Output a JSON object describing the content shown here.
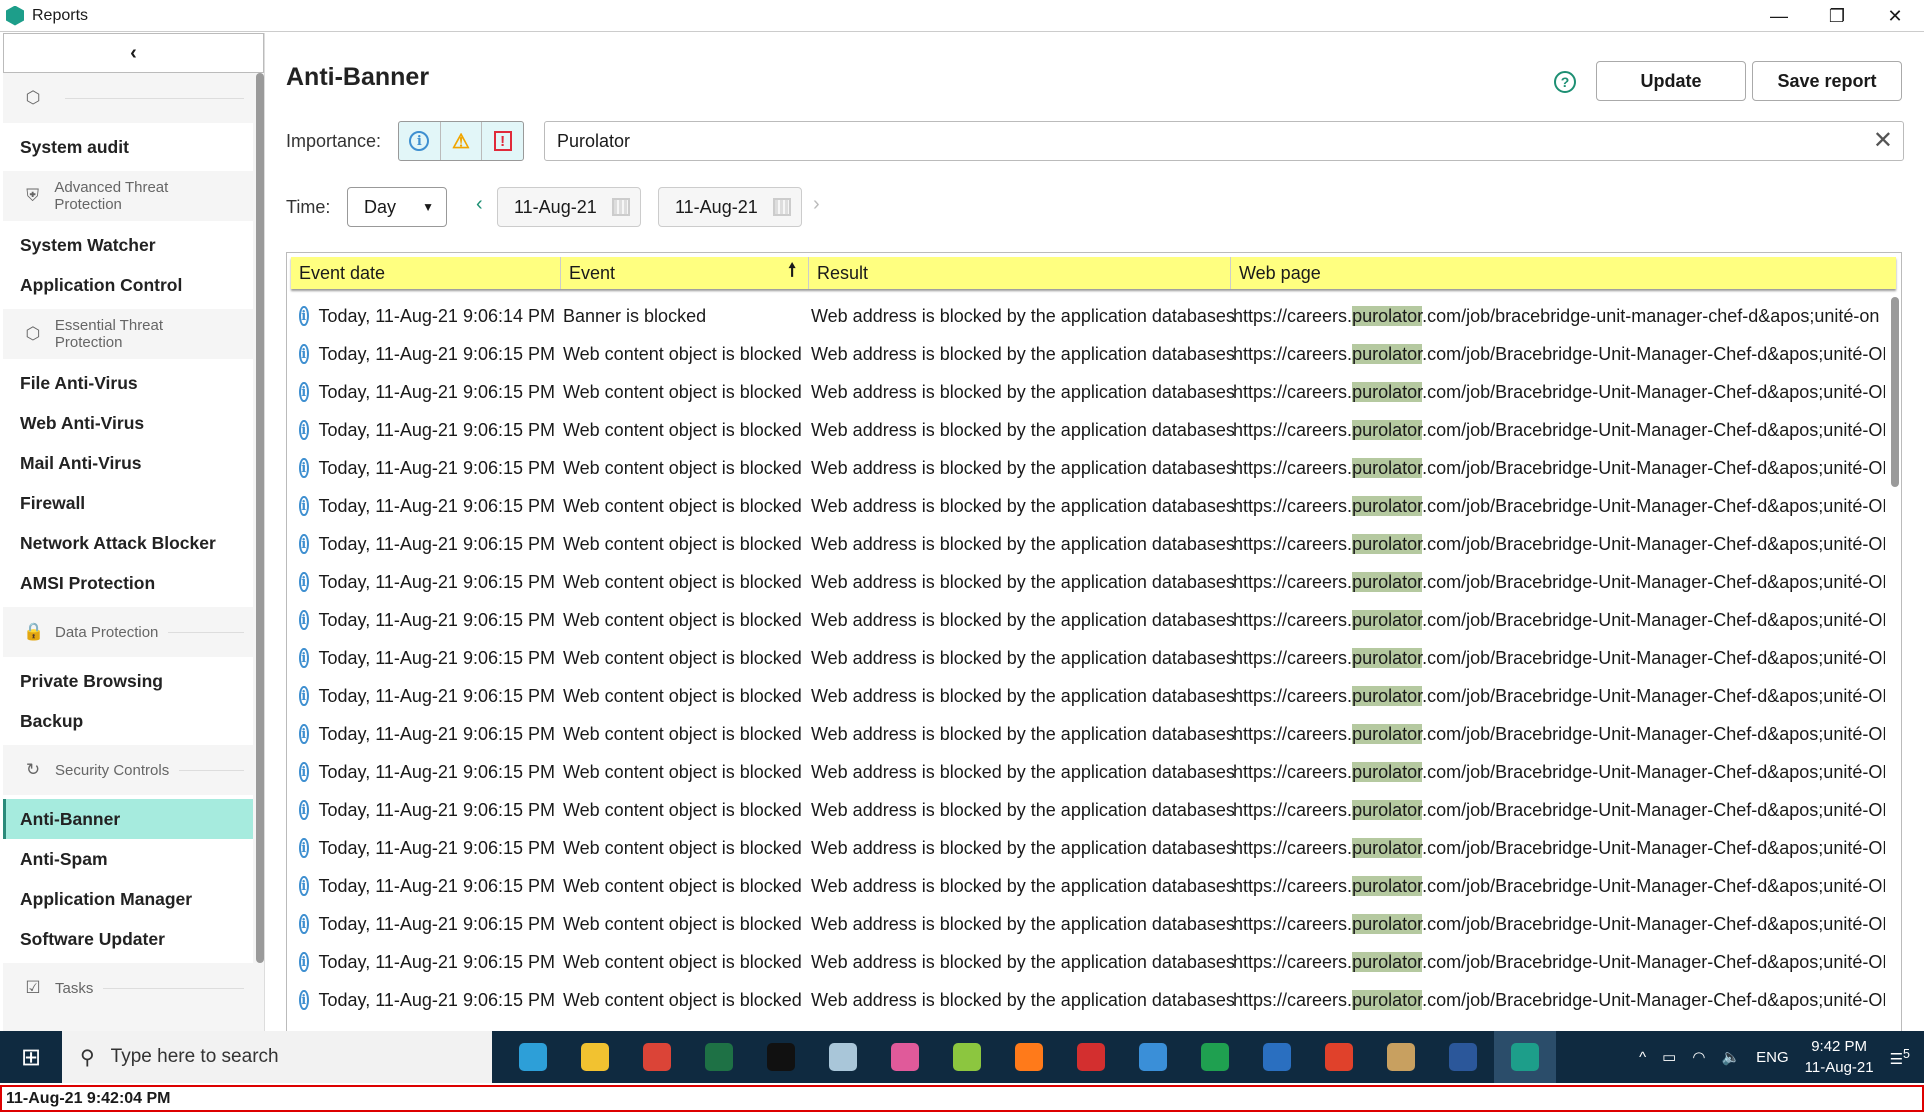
{
  "window": {
    "title": "Reports",
    "minimize": "—",
    "restore": "❐",
    "close": "✕"
  },
  "sidebar": {
    "collapse_icon": "‹",
    "sections": [
      {
        "icon": "⬡",
        "label": "",
        "items": [
          "System audit"
        ]
      },
      {
        "icon": "⛨",
        "label": "Advanced Threat Protection",
        "items": [
          "System Watcher",
          "Application Control"
        ]
      },
      {
        "icon": "⬡",
        "label": "Essential Threat Protection",
        "items": [
          "File Anti-Virus",
          "Web Anti-Virus",
          "Mail Anti-Virus",
          "Firewall",
          "Network Attack Blocker",
          "AMSI Protection"
        ]
      },
      {
        "icon": "🔒",
        "label": "Data Protection",
        "items": [
          "Private Browsing",
          "Backup"
        ]
      },
      {
        "icon": "↻",
        "label": "Security Controls",
        "items": [
          "Anti-Banner",
          "Anti-Spam",
          "Application Manager",
          "Software Updater"
        ]
      },
      {
        "icon": "☑",
        "label": "Tasks",
        "items": []
      }
    ],
    "active_item": "Anti-Banner"
  },
  "header": {
    "title": "Anti-Banner",
    "help_icon": "?",
    "update_label": "Update",
    "save_label": "Save report"
  },
  "filters": {
    "importance_label": "Importance:",
    "importance_icons": {
      "info": "i",
      "warning": "⚠",
      "critical": "!"
    },
    "search_value": "Purolator",
    "clear_icon": "✕",
    "time_label": "Time:",
    "period": "Day",
    "prev_icon": "‹",
    "next_icon": "›",
    "date_from": "11-Aug-21",
    "date_to": "11-Aug-21"
  },
  "table": {
    "columns": [
      "Event date",
      "Event",
      "Result",
      "Web page"
    ],
    "sort_icon": "🠕",
    "highlight": "purolator",
    "rows": [
      {
        "date": "Today, 11-Aug-21 9:06:14 PM",
        "event": "Banner is blocked",
        "result": "Web address is blocked by the application databases",
        "url": "https://careers.purolator.com/job/bracebridge-unit-manager-chef-d&apos;unité-on"
      },
      {
        "date": "Today, 11-Aug-21 9:06:15 PM",
        "event": "Web content object is blocked",
        "result": "Web address is blocked by the application databases",
        "url": "https://careers.purolator.com/job/Bracebridge-Unit-Manager-Chef-d&apos;unité-ON"
      },
      {
        "date": "Today, 11-Aug-21 9:06:15 PM",
        "event": "Web content object is blocked",
        "result": "Web address is blocked by the application databases",
        "url": "https://careers.purolator.com/job/Bracebridge-Unit-Manager-Chef-d&apos;unité-ON"
      },
      {
        "date": "Today, 11-Aug-21 9:06:15 PM",
        "event": "Web content object is blocked",
        "result": "Web address is blocked by the application databases",
        "url": "https://careers.purolator.com/job/Bracebridge-Unit-Manager-Chef-d&apos;unité-ON"
      },
      {
        "date": "Today, 11-Aug-21 9:06:15 PM",
        "event": "Web content object is blocked",
        "result": "Web address is blocked by the application databases",
        "url": "https://careers.purolator.com/job/Bracebridge-Unit-Manager-Chef-d&apos;unité-ON"
      },
      {
        "date": "Today, 11-Aug-21 9:06:15 PM",
        "event": "Web content object is blocked",
        "result": "Web address is blocked by the application databases",
        "url": "https://careers.purolator.com/job/Bracebridge-Unit-Manager-Chef-d&apos;unité-ON"
      },
      {
        "date": "Today, 11-Aug-21 9:06:15 PM",
        "event": "Web content object is blocked",
        "result": "Web address is blocked by the application databases",
        "url": "https://careers.purolator.com/job/Bracebridge-Unit-Manager-Chef-d&apos;unité-ON"
      },
      {
        "date": "Today, 11-Aug-21 9:06:15 PM",
        "event": "Web content object is blocked",
        "result": "Web address is blocked by the application databases",
        "url": "https://careers.purolator.com/job/Bracebridge-Unit-Manager-Chef-d&apos;unité-ON"
      },
      {
        "date": "Today, 11-Aug-21 9:06:15 PM",
        "event": "Web content object is blocked",
        "result": "Web address is blocked by the application databases",
        "url": "https://careers.purolator.com/job/Bracebridge-Unit-Manager-Chef-d&apos;unité-ON"
      },
      {
        "date": "Today, 11-Aug-21 9:06:15 PM",
        "event": "Web content object is blocked",
        "result": "Web address is blocked by the application databases",
        "url": "https://careers.purolator.com/job/Bracebridge-Unit-Manager-Chef-d&apos;unité-ON"
      },
      {
        "date": "Today, 11-Aug-21 9:06:15 PM",
        "event": "Web content object is blocked",
        "result": "Web address is blocked by the application databases",
        "url": "https://careers.purolator.com/job/Bracebridge-Unit-Manager-Chef-d&apos;unité-ON"
      },
      {
        "date": "Today, 11-Aug-21 9:06:15 PM",
        "event": "Web content object is blocked",
        "result": "Web address is blocked by the application databases",
        "url": "https://careers.purolator.com/job/Bracebridge-Unit-Manager-Chef-d&apos;unité-ON"
      },
      {
        "date": "Today, 11-Aug-21 9:06:15 PM",
        "event": "Web content object is blocked",
        "result": "Web address is blocked by the application databases",
        "url": "https://careers.purolator.com/job/Bracebridge-Unit-Manager-Chef-d&apos;unité-ON"
      },
      {
        "date": "Today, 11-Aug-21 9:06:15 PM",
        "event": "Web content object is blocked",
        "result": "Web address is blocked by the application databases",
        "url": "https://careers.purolator.com/job/Bracebridge-Unit-Manager-Chef-d&apos;unité-ON"
      },
      {
        "date": "Today, 11-Aug-21 9:06:15 PM",
        "event": "Web content object is blocked",
        "result": "Web address is blocked by the application databases",
        "url": "https://careers.purolator.com/job/Bracebridge-Unit-Manager-Chef-d&apos;unité-ON"
      },
      {
        "date": "Today, 11-Aug-21 9:06:15 PM",
        "event": "Web content object is blocked",
        "result": "Web address is blocked by the application databases",
        "url": "https://careers.purolator.com/job/Bracebridge-Unit-Manager-Chef-d&apos;unité-ON"
      },
      {
        "date": "Today, 11-Aug-21 9:06:15 PM",
        "event": "Web content object is blocked",
        "result": "Web address is blocked by the application databases",
        "url": "https://careers.purolator.com/job/Bracebridge-Unit-Manager-Chef-d&apos;unité-ON"
      },
      {
        "date": "Today, 11-Aug-21 9:06:15 PM",
        "event": "Web content object is blocked",
        "result": "Web address is blocked by the application databases",
        "url": "https://careers.purolator.com/job/Bracebridge-Unit-Manager-Chef-d&apos;unité-ON"
      },
      {
        "date": "Today, 11-Aug-21 9:06:15 PM",
        "event": "Web content object is blocked",
        "result": "Web address is blocked by the application databases",
        "url": "https://careers.purolator.com/job/Bracebridge-Unit-Manager-Chef-d&apos;unité-ON"
      }
    ]
  },
  "taskbar": {
    "start_icon": "⊞",
    "search_placeholder": "Type here to search",
    "search_icon": "⚲",
    "apps": [
      {
        "name": "edge",
        "color": "#2d9fd8"
      },
      {
        "name": "file-explorer",
        "color": "#f2c230"
      },
      {
        "name": "chrome",
        "color": "#db4437"
      },
      {
        "name": "excel",
        "color": "#1e7145"
      },
      {
        "name": "terminal",
        "color": "#111111"
      },
      {
        "name": "notes",
        "color": "#a9c6d9"
      },
      {
        "name": "paint",
        "color": "#e05a9a"
      },
      {
        "name": "green-app",
        "color": "#8cc63f"
      },
      {
        "name": "firefox",
        "color": "#ff7a1a"
      },
      {
        "name": "red-app",
        "color": "#d32f2f"
      },
      {
        "name": "control-panel",
        "color": "#3a8fd8"
      },
      {
        "name": "green-circle-app",
        "color": "#1fa050"
      },
      {
        "name": "photos",
        "color": "#2a6fc0"
      },
      {
        "name": "red-circle-app",
        "color": "#e0412b"
      },
      {
        "name": "paint-palette",
        "color": "#c8a060"
      },
      {
        "name": "word",
        "color": "#2b579a"
      },
      {
        "name": "kaspersky",
        "color": "#1d9e8a"
      }
    ],
    "active_app": "kaspersky",
    "tray": {
      "chevron": "^",
      "lang": "ENG",
      "time": "9:42 PM",
      "date": "11-Aug-21",
      "notifications": "5"
    }
  },
  "status_bar": {
    "timestamp": "11-Aug-21 9:42:04 PM"
  },
  "colors": {
    "accent": "#1d9e8a",
    "active_item": "#a6ebde",
    "table_header": "#ffff80",
    "highlight": "#b5c9a0"
  }
}
